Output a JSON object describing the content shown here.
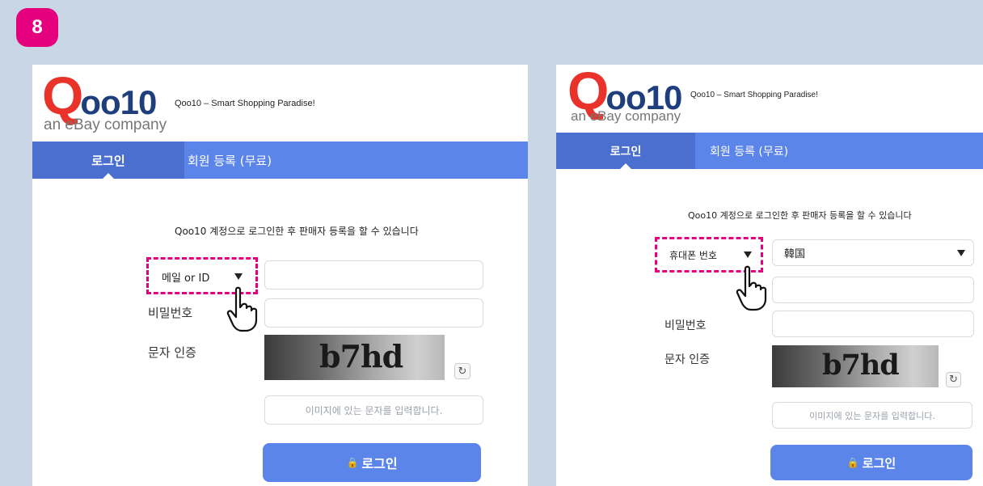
{
  "step_number": "8",
  "logo": {
    "brand": "Qoo10",
    "brand_q": "Q",
    "brand_rest": "oo10",
    "sub": "an eBay company",
    "tagline": "Qoo10 – Smart Shopping Paradise!"
  },
  "tabs": {
    "login": "로그인",
    "register": "회원 등록 (무료)"
  },
  "info_text": "Qoo10 계정으로 로그인한 후 판매자 등록을 할 수 있습니다",
  "labels": {
    "password": "비밀번호",
    "captcha": "문자 인증"
  },
  "left": {
    "id_type": "메일 or ID"
  },
  "right": {
    "id_type": "휴대폰 번호",
    "country": "韓国"
  },
  "captcha_text": "b7hd",
  "captcha_placeholder": "이미지에 있는 문자를 입력합니다.",
  "login_button": "로그인",
  "icons": {
    "lock": "lock-icon",
    "refresh": "refresh-icon",
    "hand": "hand-pointer-icon",
    "dropdown": "triangle-down-icon"
  },
  "colors": {
    "badge": "#e5007e",
    "tab_bar": "#5b85e8",
    "button": "#5b85e8",
    "highlight": "#e5007e"
  }
}
